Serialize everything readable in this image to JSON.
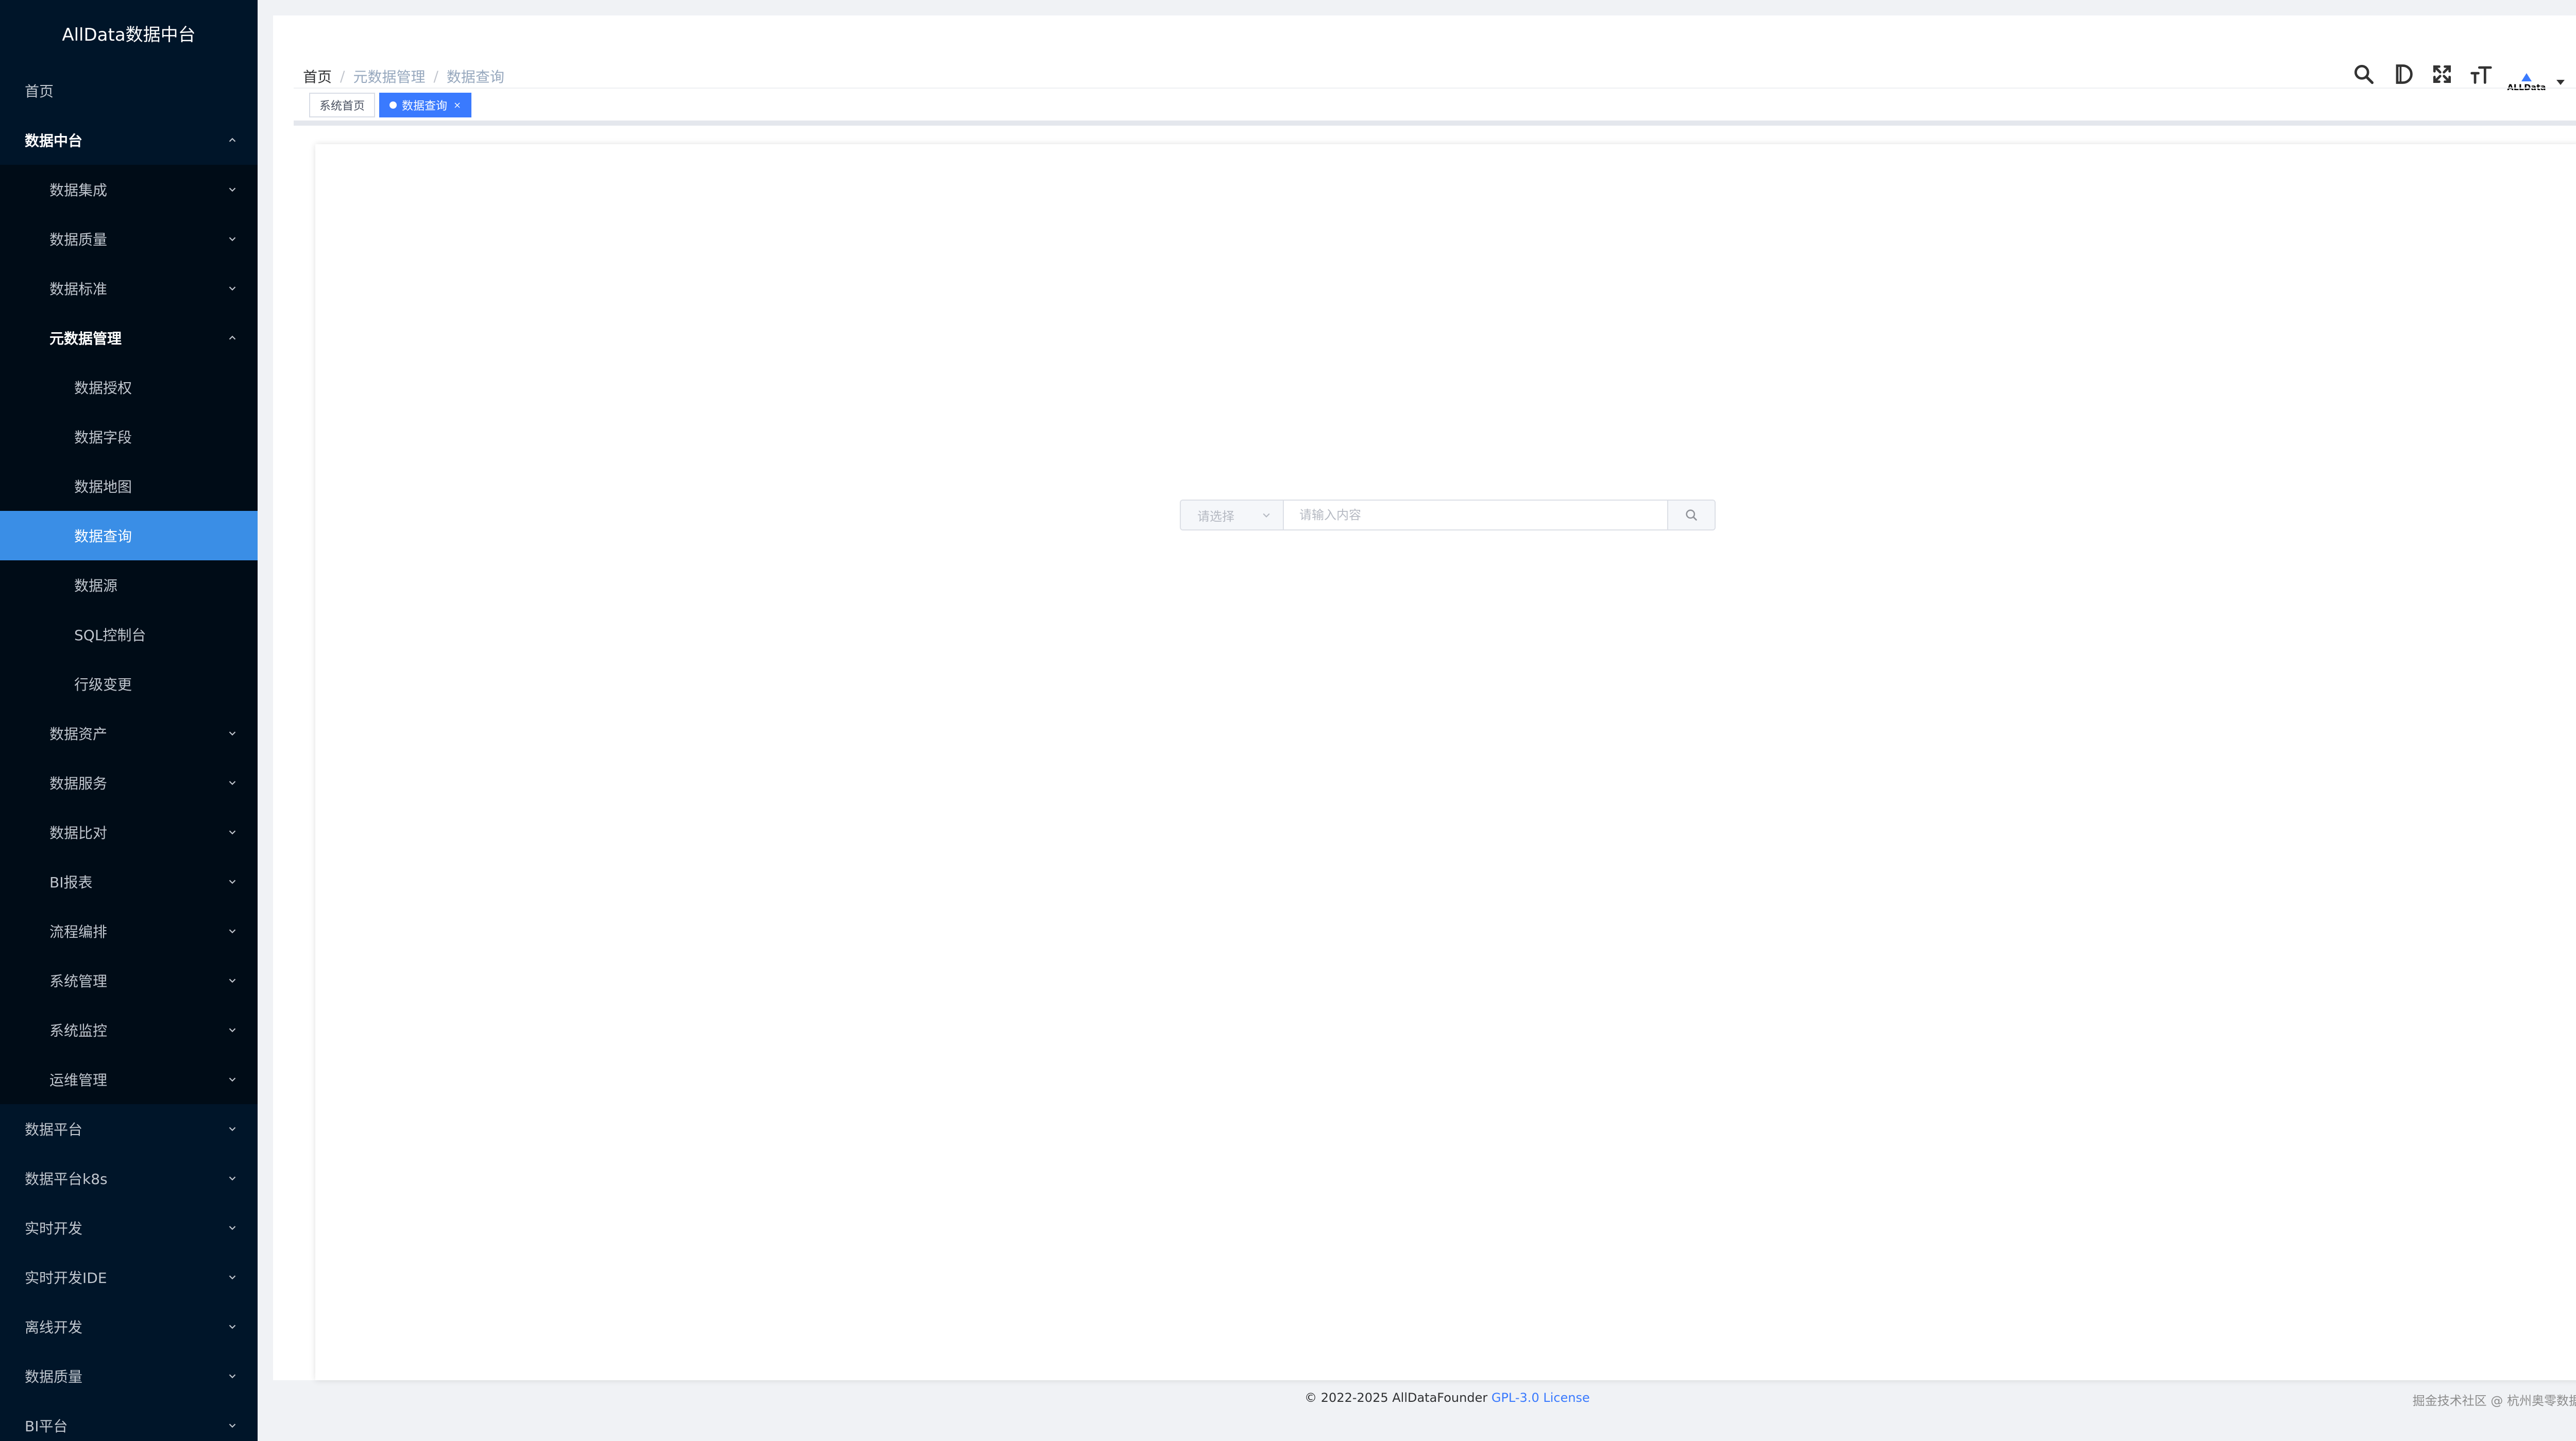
{
  "app": {
    "title": "AllData数据中台"
  },
  "sidebar": {
    "items": [
      {
        "label": "首页",
        "level": 0,
        "bold": false,
        "arrow": "none",
        "active": false
      },
      {
        "label": "数据中台",
        "level": 0,
        "bold": true,
        "arrow": "up",
        "active": false
      },
      {
        "label": "数据集成",
        "level": 1,
        "bold": false,
        "arrow": "down",
        "active": false
      },
      {
        "label": "数据质量",
        "level": 1,
        "bold": false,
        "arrow": "down",
        "active": false
      },
      {
        "label": "数据标准",
        "level": 1,
        "bold": false,
        "arrow": "down",
        "active": false
      },
      {
        "label": "元数据管理",
        "level": 1,
        "bold": true,
        "arrow": "up",
        "active": false
      },
      {
        "label": "数据授权",
        "level": 2,
        "bold": false,
        "arrow": "none",
        "active": false
      },
      {
        "label": "数据字段",
        "level": 2,
        "bold": false,
        "arrow": "none",
        "active": false
      },
      {
        "label": "数据地图",
        "level": 2,
        "bold": false,
        "arrow": "none",
        "active": false
      },
      {
        "label": "数据查询",
        "level": 2,
        "bold": false,
        "arrow": "none",
        "active": true
      },
      {
        "label": "数据源",
        "level": 2,
        "bold": false,
        "arrow": "none",
        "active": false
      },
      {
        "label": "SQL控制台",
        "level": 2,
        "bold": false,
        "arrow": "none",
        "active": false
      },
      {
        "label": "行级变更",
        "level": 2,
        "bold": false,
        "arrow": "none",
        "active": false
      },
      {
        "label": "数据资产",
        "level": 1,
        "bold": false,
        "arrow": "down",
        "active": false
      },
      {
        "label": "数据服务",
        "level": 1,
        "bold": false,
        "arrow": "down",
        "active": false
      },
      {
        "label": "数据比对",
        "level": 1,
        "bold": false,
        "arrow": "down",
        "active": false
      },
      {
        "label": "BI报表",
        "level": 1,
        "bold": false,
        "arrow": "down",
        "active": false
      },
      {
        "label": "流程编排",
        "level": 1,
        "bold": false,
        "arrow": "down",
        "active": false
      },
      {
        "label": "系统管理",
        "level": 1,
        "bold": false,
        "arrow": "down",
        "active": false
      },
      {
        "label": "系统监控",
        "level": 1,
        "bold": false,
        "arrow": "down",
        "active": false
      },
      {
        "label": "运维管理",
        "level": 1,
        "bold": false,
        "arrow": "down",
        "active": false
      },
      {
        "label": "数据平台",
        "level": 0,
        "bold": false,
        "arrow": "down",
        "active": false
      },
      {
        "label": "数据平台k8s",
        "level": 0,
        "bold": false,
        "arrow": "down",
        "active": false
      },
      {
        "label": "实时开发",
        "level": 0,
        "bold": false,
        "arrow": "down",
        "active": false
      },
      {
        "label": "实时开发IDE",
        "level": 0,
        "bold": false,
        "arrow": "down",
        "active": false
      },
      {
        "label": "离线开发",
        "level": 0,
        "bold": false,
        "arrow": "down",
        "active": false
      },
      {
        "label": "数据质量",
        "level": 0,
        "bold": false,
        "arrow": "down",
        "active": false
      },
      {
        "label": "BI平台",
        "level": 0,
        "bold": false,
        "arrow": "down",
        "active": false
      }
    ]
  },
  "breadcrumb": {
    "home": "首页",
    "parent": "元数据管理",
    "current": "数据查询",
    "separator": "/"
  },
  "tabs": [
    {
      "label": "系统首页",
      "active": false
    },
    {
      "label": "数据查询",
      "active": true,
      "close": "×"
    }
  ],
  "header": {
    "icons": [
      "search-icon",
      "document-d-icon",
      "fullscreen-icon",
      "font-size-icon"
    ],
    "user_logo_text": "ALLData"
  },
  "search": {
    "select_placeholder": "请选择",
    "input_placeholder": "请输入内容",
    "input_value": ""
  },
  "footer": {
    "copyright": "© 2022-2025 AllDataFounder",
    "license": "GPL-3.0 License",
    "watermark": "掘金技术社区 @ 杭州奥零数据科技"
  },
  "colors": {
    "sidebar_bg": "#001529",
    "sidebar_sub_bg": "#000c17",
    "active_item": "#3a8ee6",
    "tab_active": "#3a7afe",
    "link": "#3a7afe"
  }
}
